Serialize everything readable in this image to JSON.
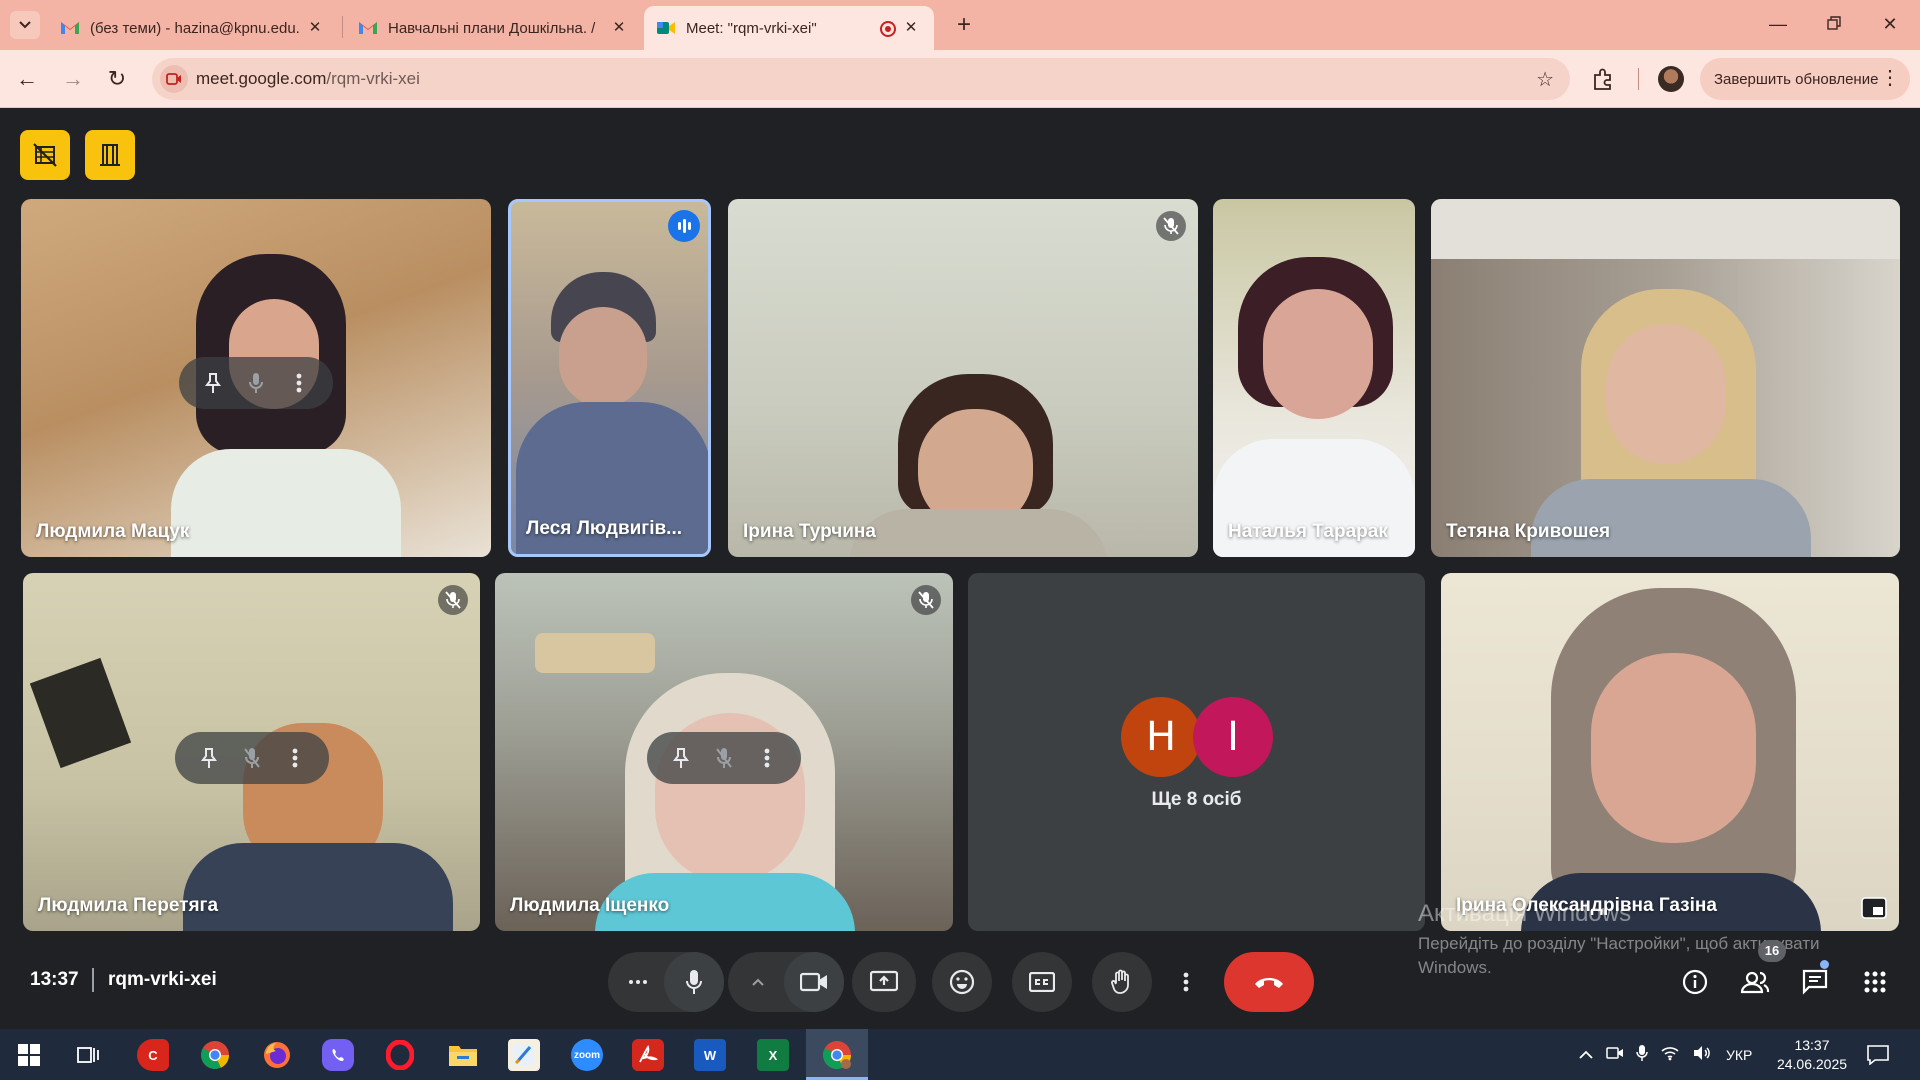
{
  "browser": {
    "tabs": [
      {
        "title": "(без теми) - hazina@kpnu.edu.ua",
        "active": false
      },
      {
        "title": "Навчальні плани Дошкільна. /",
        "active": false
      },
      {
        "title": "Meet: \"rqm-vrki-xei\"",
        "active": true
      }
    ],
    "url_host": "meet.google.com",
    "url_path": "/rqm-vrki-xei",
    "update_label": "Завершить обновление",
    "colors": {
      "chrome": "#f3b4a6",
      "active_tab": "#fde6df"
    }
  },
  "meet": {
    "participants_row1": [
      {
        "name": "Людмила Мацук",
        "muted": false,
        "hover": true
      },
      {
        "name": "Леся Людвигів...",
        "speaking": true
      },
      {
        "name": "Ірина Турчина",
        "muted": true
      },
      {
        "name": "Наталья Тарарак",
        "muted": false
      },
      {
        "name": "Тетяна Кривошея",
        "muted": false
      }
    ],
    "participants_row2": [
      {
        "name": "Людмила Перетяга",
        "muted": true,
        "hover": true
      },
      {
        "name": "Людмила Іщенко",
        "muted": true,
        "hover": true
      },
      {
        "name": "Ірина Олександрівна Газіна",
        "muted": false
      }
    ],
    "more_tile": {
      "avatars": [
        {
          "letter": "Н",
          "color": "#c1440e"
        },
        {
          "letter": "І",
          "color": "#c2185b"
        }
      ],
      "label": "Ще 8 осіб"
    },
    "clock": "13:37",
    "meeting_code": "rqm-vrki-xei",
    "people_count": "16",
    "icons": [
      "no-video-icon",
      "door-icon",
      "more-icon",
      "mic-icon",
      "chevron-up-icon",
      "camera-icon",
      "present-icon",
      "emoji-icon",
      "captions-icon",
      "raise-hand-icon",
      "more-vert-icon",
      "end-call-icon",
      "info-icon",
      "people-icon",
      "chat-icon",
      "apps-icon"
    ],
    "colors": {
      "background": "#202124",
      "end_call": "#dc362e",
      "accent_yellow": "#f9c20d"
    }
  },
  "watermark": {
    "title": "Активація Windows",
    "text": "Перейдіть до розділу \"Настройки\", щоб активувати Windows."
  },
  "taskbar": {
    "lang": "УКР",
    "time": "13:37",
    "date": "24.06.2025",
    "apps": [
      "start-icon",
      "task-view-icon",
      "app-red-icon",
      "chrome-icon",
      "firefox-icon",
      "viber-icon",
      "opera-icon",
      "explorer-icon",
      "notes-icon",
      "zoom-icon",
      "acrobat-icon",
      "word-icon",
      "excel-icon",
      "chrome-active-icon"
    ]
  }
}
